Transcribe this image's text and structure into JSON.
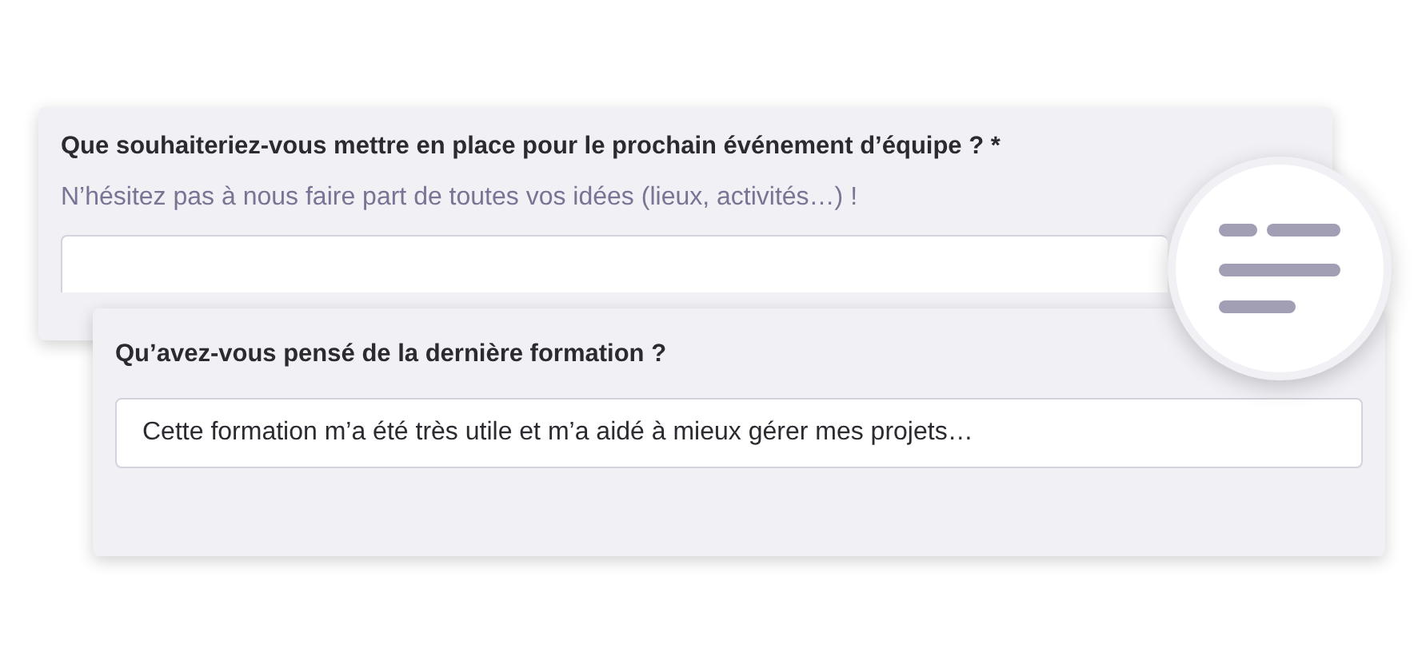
{
  "cards": [
    {
      "question": "Que souhaiteriez-vous mettre en place pour le prochain événement d’équipe ? *",
      "hint": "N’hésitez pas à nous faire part de toutes vos idées (lieux, activités…) !"
    },
    {
      "question": "Qu’avez-vous pensé de la dernière formation ?",
      "value": "Cette formation m’a été très utile et m’a aidé à mieux gérer mes projets…"
    }
  ]
}
